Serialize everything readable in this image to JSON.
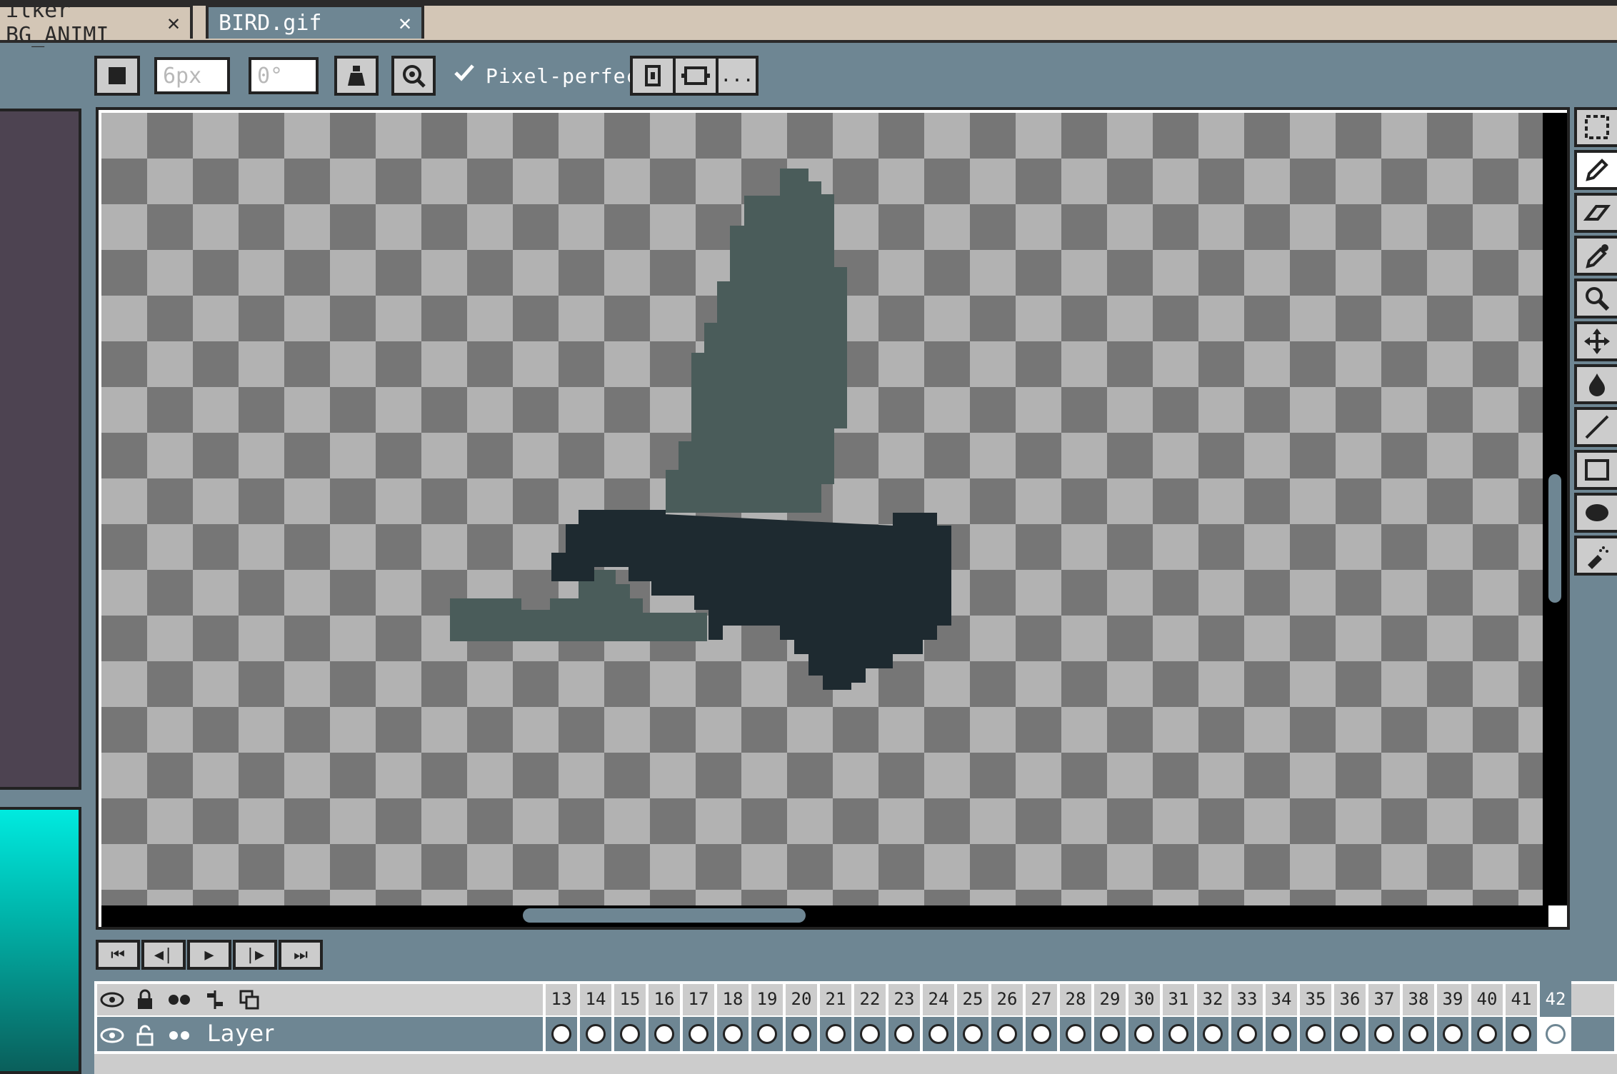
{
  "app": {
    "accent": "#6e8693",
    "panel_purple": "#4d4351"
  },
  "tabs": [
    {
      "label": "Walker_BG_ANIM",
      "visible_text": "ilker BG_ANIMI",
      "close": "✕"
    },
    {
      "label": "BIRD.gif",
      "close": "✕"
    }
  ],
  "toolbar": {
    "brush_size_value": "6px",
    "angle_value": "0°",
    "pixel_perfect_checked": true,
    "pixel_perfect_label": "Pixel-perfect",
    "more_label": "..."
  },
  "tools": [
    "marquee-icon",
    "pencil-icon",
    "eraser-icon",
    "eyedropper-icon",
    "zoom-icon",
    "move-icon",
    "fill-icon",
    "line-icon",
    "rectangle-icon",
    "ellipse-icon",
    "spray-icon"
  ],
  "playback": [
    "⏮",
    "◀|",
    "▶",
    "|▶",
    "⏭"
  ],
  "timeline": {
    "layer_name": "Layer",
    "frames": [
      "13",
      "14",
      "15",
      "16",
      "17",
      "18",
      "19",
      "20",
      "21",
      "22",
      "23",
      "24",
      "25",
      "26",
      "27",
      "28",
      "29",
      "30",
      "31",
      "32",
      "33",
      "34",
      "35",
      "36",
      "37",
      "38",
      "39",
      "40",
      "41",
      "42"
    ],
    "current_frame": "42"
  }
}
